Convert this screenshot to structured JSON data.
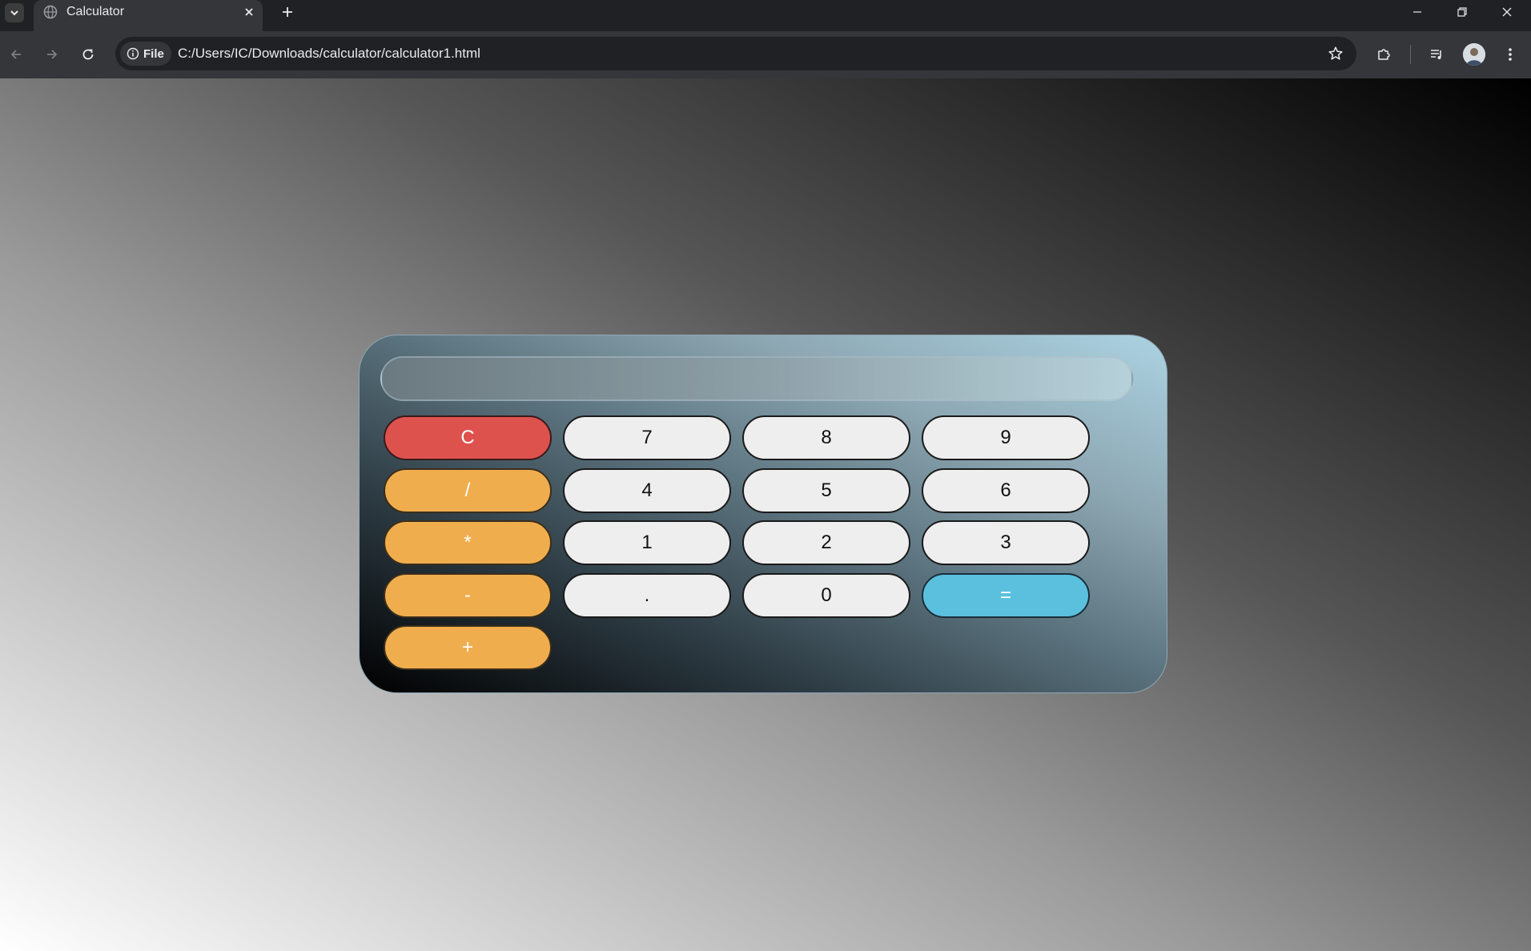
{
  "browser": {
    "tab_title": "Calculator",
    "address_chip": "File",
    "url": "C:/Users/IC/Downloads/calculator/calculator1.html"
  },
  "calculator": {
    "display_value": "",
    "keys": {
      "clear": "C",
      "divide": "/",
      "multiply": "*",
      "subtract": "-",
      "add": "+",
      "seven": "7",
      "eight": "8",
      "nine": "9",
      "four": "4",
      "five": "5",
      "six": "6",
      "one": "1",
      "two": "2",
      "three": "3",
      "decimal": ".",
      "zero": "0",
      "equals": "="
    }
  },
  "colors": {
    "clear": "#de524e",
    "operator": "#f0ad4e",
    "number": "#eeeeee",
    "equals": "#5bc0de"
  },
  "icons": {
    "tab_menu": "chevron-down-icon",
    "favicon": "globe-icon",
    "tab_close": "close-icon",
    "new_tab": "plus-icon",
    "minimize": "minimize-icon",
    "restore": "restore-icon",
    "window_close": "close-icon",
    "back": "arrow-left-icon",
    "forward": "arrow-right-icon",
    "reload": "reload-icon",
    "site_info": "info-icon",
    "bookmark": "star-icon",
    "extensions": "puzzle-icon",
    "media": "media-queue-icon",
    "profile": "avatar",
    "menu": "kebab-menu-icon"
  }
}
